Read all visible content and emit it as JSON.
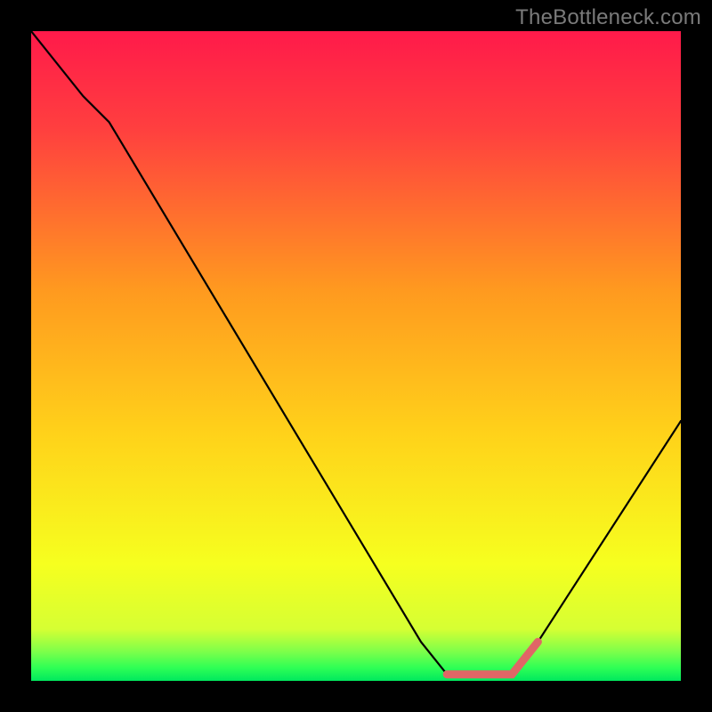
{
  "watermark": "TheBottleneck.com",
  "chart_data": {
    "type": "line",
    "title": "",
    "xlabel": "",
    "ylabel": "",
    "xlim": [
      0,
      100
    ],
    "ylim": [
      0,
      100
    ],
    "x": [
      0,
      8,
      12,
      60,
      64,
      74,
      78,
      100
    ],
    "values": [
      100,
      90,
      86,
      6,
      1,
      1,
      6,
      40
    ],
    "highlight_range_x": [
      64,
      78
    ],
    "gradient_stops": [
      {
        "pos": 0.0,
        "color": "#ff1a4a"
      },
      {
        "pos": 0.15,
        "color": "#ff3f3f"
      },
      {
        "pos": 0.4,
        "color": "#ff9a1f"
      },
      {
        "pos": 0.62,
        "color": "#ffd21a"
      },
      {
        "pos": 0.82,
        "color": "#f6ff1f"
      },
      {
        "pos": 0.92,
        "color": "#d6ff33"
      },
      {
        "pos": 0.955,
        "color": "#7dff4a"
      },
      {
        "pos": 0.98,
        "color": "#2eff55"
      },
      {
        "pos": 1.0,
        "color": "#00e85e"
      }
    ],
    "highlight_color": "#e06666",
    "curve_color": "#000000"
  }
}
